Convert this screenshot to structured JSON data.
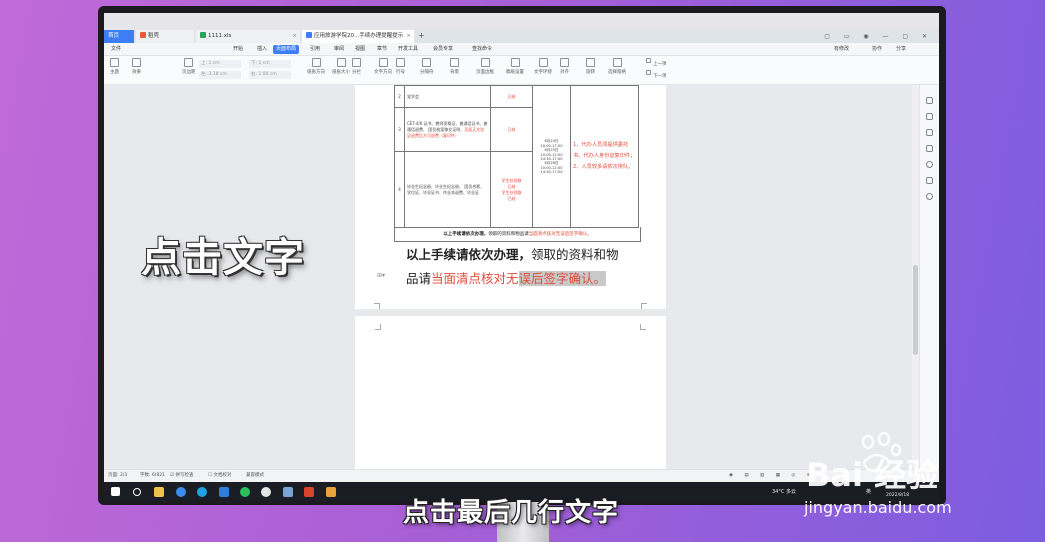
{
  "tabs": {
    "home": "首页",
    "t1": "稻壳",
    "t2": "1111.xls",
    "t3": "应用旅游学院20...手续办理提醒提示"
  },
  "menus": [
    "文件",
    "开始",
    "插入",
    "页面布局",
    "引用",
    "审阅",
    "视图",
    "章节",
    "开发工具",
    "会员专享",
    "查找命令"
  ],
  "active_menu_index": 3,
  "menu_right": {
    "modified": "有修改",
    "collab": "协作",
    "share": "分享"
  },
  "toolbar": {
    "items": [
      "主题",
      "效果",
      "页边距",
      "纸张方向",
      "纸张大小",
      "分栏",
      "文字方向",
      "行号",
      "分隔符",
      "背景",
      "页面边框",
      "稿纸设置",
      "文字环绕",
      "对齐",
      "旋转",
      "选择窗格",
      "上一项",
      "下一项"
    ],
    "fields": {
      "top_label": "上:",
      "top_val": "1 cm",
      "left_label": "左:",
      "left_val": "3.18 cm",
      "bottom_label": "下:",
      "bottom_val": "1 cm",
      "right_label": "右:",
      "right_val": "1.88 cm"
    }
  },
  "table": {
    "rows": [
      {
        "num": "2",
        "desc": "党学会",
        "fee": "已结",
        "date": "",
        "note": ""
      },
      {
        "num": "3",
        "desc": "CET-4/6 证书、教师资格证、普通话证书、普通话退费、 团员档案移交证明、",
        "desc_red": "页面正文验证退费后方可退费（复印件）",
        "fee": "已结",
        "date": "6月24日\n10:00-17:00\n6月25日\n10:00-12:00\n14:30-17:00\n6月26日\n10:00-12:00\n14:30-17:00",
        "note": ""
      },
      {
        "num": "4",
        "desc": "毕业生纪念册、毕业生纪念册、 团员合影、学位证、毕业证书、作业本退费、毕业证",
        "fee": "学生处领取\n已结\n学生处领取\n已结",
        "date": "",
        "note": ""
      }
    ],
    "note_column": "1、代办人员须提供委托书、代办人身份证复印件；\n2、人员较多请依次排队。",
    "footer_bold": "以上手续请依次办理，",
    "footer_normal": "领取的资料和物品请",
    "footer_red": "当面清点核对无误后签字确认。"
  },
  "body": {
    "line1_bold": "以上手续请依次办理，",
    "line1_normal": "领取的资料和物",
    "line2_normal": "品请",
    "line2_red": "当面清点核对无",
    "line2_selected": "误后签字确认。"
  },
  "status": {
    "page": "页面: 2/3",
    "words": "字数: 6/821",
    "spell": "拼写检查",
    "proof": "文档校对",
    "compat": "兼容模式"
  },
  "taskbar": {
    "weather": "34°C 多云",
    "lang": "英",
    "time": "2022/8/18"
  },
  "overlays": {
    "left_caption": "点击文字",
    "bottom_caption": "点击最后几行文字",
    "watermark_logo": "Bai 经验",
    "watermark_url": "jingyan.baidu.com"
  }
}
